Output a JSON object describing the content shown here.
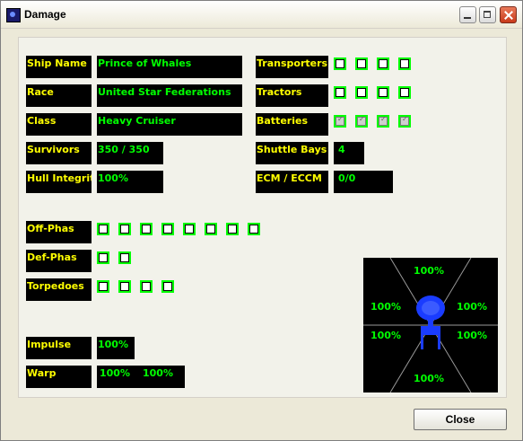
{
  "window": {
    "title": "Damage"
  },
  "ship": {
    "name_label": "Ship Name",
    "name_value": "Prince of Whales",
    "race_label": "Race",
    "race_value": "United Star Federations",
    "class_label": "Class",
    "class_value": "Heavy Cruiser",
    "survivors_label": "Survivors",
    "survivors_value": "350 / 350",
    "hull_label": "Hull Integrity",
    "hull_value": "100%"
  },
  "systems": {
    "transporters_label": "Transporters",
    "tractors_label": "Tractors",
    "batteries_label": "Batteries",
    "shuttle_label": "Shuttle Bays",
    "shuttle_value": "4",
    "ecm_label": "ECM / ECCM",
    "ecm_value": "0/0",
    "transporters_states": [
      false,
      false,
      false,
      false
    ],
    "tractors_states": [
      false,
      false,
      false,
      false
    ],
    "batteries_states": [
      true,
      true,
      true,
      true
    ]
  },
  "weapons": {
    "offphas_label": "Off-Phas",
    "defphas_label": "Def-Phas",
    "torpedoes_label": "Torpedoes",
    "offphas_states": [
      false,
      false,
      false,
      false,
      false,
      false,
      false,
      false
    ],
    "defphas_states": [
      false,
      false
    ],
    "torpedoes_states": [
      false,
      false,
      false,
      false
    ]
  },
  "engines": {
    "impulse_label": "Impulse",
    "impulse_value": "100%",
    "warp_label": "Warp",
    "warp_left": "100%",
    "warp_right": "100%"
  },
  "shields": {
    "top": "100%",
    "upper_left": "100%",
    "upper_right": "100%",
    "lower_left": "100%",
    "lower_right": "100%",
    "bottom": "100%"
  },
  "buttons": {
    "close_label": "Close"
  },
  "colors": {
    "label_text": "#ffff00",
    "value_text": "#00ff00",
    "field_bg": "#000000",
    "checkbox_border": "#00ff00"
  }
}
